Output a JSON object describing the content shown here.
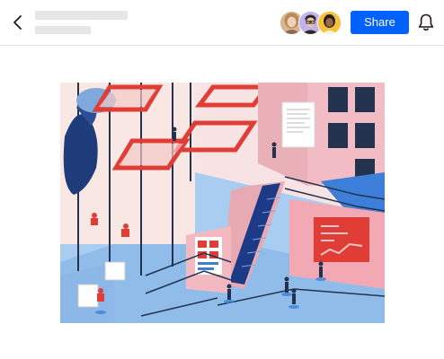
{
  "header": {
    "back_icon": "chevron-left-icon",
    "title": "",
    "subtitle": "",
    "collaborators": [
      {
        "avatar": "avatar-1"
      },
      {
        "avatar": "avatar-2"
      },
      {
        "avatar": "avatar-3"
      }
    ],
    "share_label": "Share",
    "notification_icon": "bell-icon"
  },
  "colors": {
    "accent": "#0061fe",
    "illustration_pink": "#f2c0c6",
    "illustration_blue": "#3e84d8",
    "illustration_red": "#e0483a",
    "illustration_navy": "#1c2f66"
  },
  "preview": {
    "type": "illustration"
  }
}
